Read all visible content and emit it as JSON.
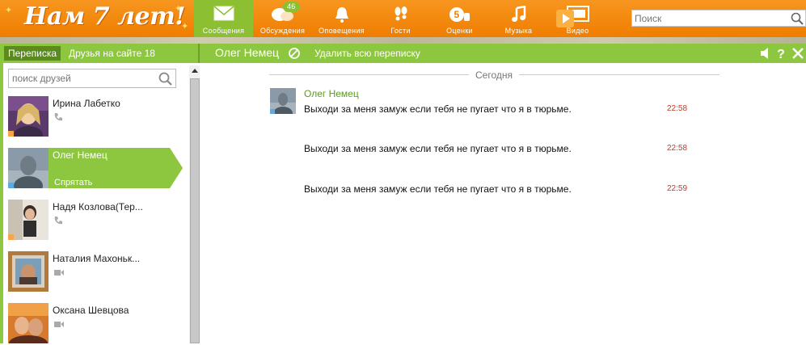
{
  "logo": {
    "text": "Нам 7 лет!"
  },
  "nav": {
    "items": [
      {
        "label": "Сообщения",
        "icon": "envelope-icon",
        "active": true
      },
      {
        "label": "Обсуждения",
        "icon": "discussion-icon",
        "badge": "46"
      },
      {
        "label": "Оповещения",
        "icon": "bell-icon"
      },
      {
        "label": "Гости",
        "icon": "footprints-icon"
      },
      {
        "label": "Оценки",
        "icon": "rating-five-icon"
      },
      {
        "label": "Музыка",
        "icon": "music-note-icon"
      },
      {
        "label": "Видео",
        "icon": "video-icon"
      }
    ]
  },
  "search": {
    "placeholder": "Поиск"
  },
  "chat_header": {
    "tab_messages": "Переписка",
    "tab_friends": "Друзья на сайте 18",
    "contact_name": "Олег Немец",
    "delete_all": "Удалить всю переписку"
  },
  "left_panel": {
    "search_placeholder": "поиск друзей",
    "friends": [
      {
        "name": "Ирина Лабетко",
        "status_icon": "phone-icon"
      },
      {
        "name": "Олег Немец",
        "hide_label": "Спрятать",
        "selected": true
      },
      {
        "name": "Надя Козлова(Тер...",
        "status_icon": "phone-icon"
      },
      {
        "name": "Наталия Махоньк...",
        "status_icon": "video-camera-icon"
      },
      {
        "name": "Оксана Шевцова",
        "status_icon": "video-camera-icon"
      }
    ]
  },
  "chat": {
    "date_separator": "Сегодня",
    "author": "Олег Немец",
    "messages": [
      {
        "text": "Выходи за меня замуж если тебя не пугает что я в тюрьме.",
        "time": "22:58"
      },
      {
        "text": "Выходи за меня замуж если тебя не пугает что я в тюрьме.",
        "time": "22:58"
      },
      {
        "text": "Выходи за меня замуж если тебя не пугает что я в тюрьме.",
        "time": "22:59"
      }
    ]
  },
  "colors": {
    "orange": "#ef7d00",
    "green": "#8dc63f",
    "dark_green_tab": "#5b8a1f",
    "time_red": "#c0392b",
    "author_green": "#5c9a1d"
  }
}
